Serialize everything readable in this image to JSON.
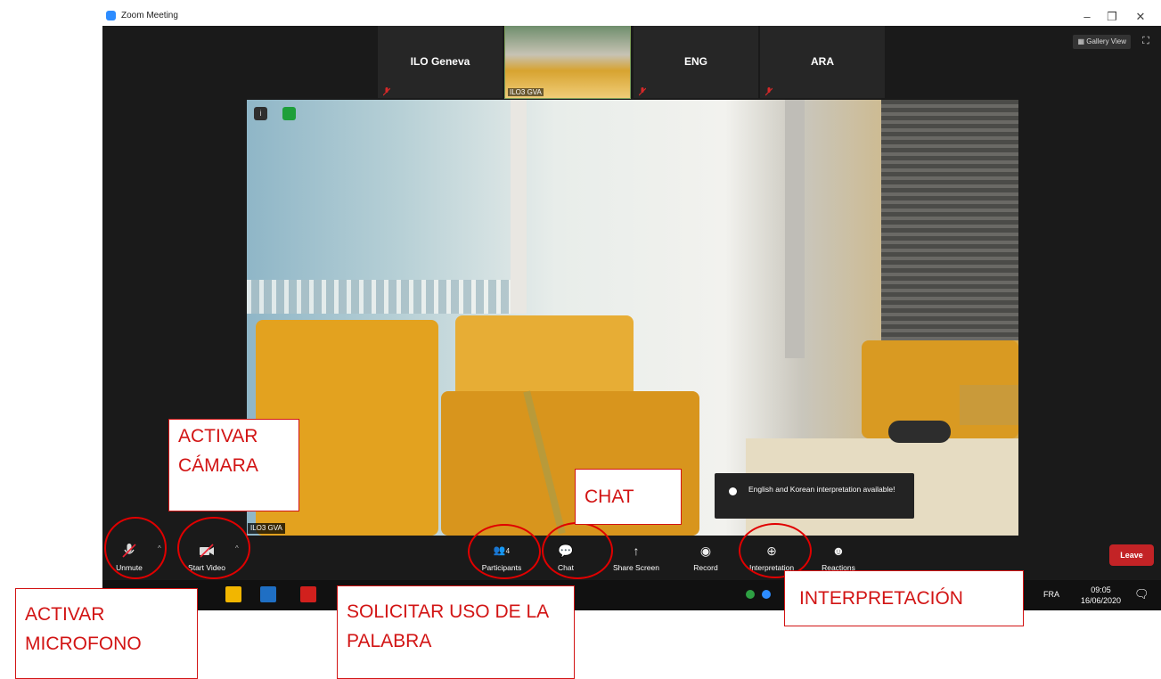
{
  "window": {
    "title": "Zoom Meeting",
    "controls": {
      "minimize": "–",
      "restore": "❐",
      "close": "✕"
    }
  },
  "top_bar": {
    "gallery_view_label": "Gallery View",
    "thumbnails": [
      {
        "name": "ILO Geneva",
        "muted": true
      },
      {
        "name": "ILO3 GVA",
        "video": true
      },
      {
        "name": "ENG",
        "muted": true
      },
      {
        "name": "ARA",
        "muted": true
      }
    ]
  },
  "video": {
    "participant_name": "ILO3 GVA"
  },
  "tooltip": {
    "text": "English and Korean interpretation available!"
  },
  "toolbar": {
    "unmute": "Unmute",
    "start_video": "Start Video",
    "participants": "Participants",
    "participants_count": "4",
    "chat": "Chat",
    "share_screen": "Share Screen",
    "record": "Record",
    "interpretation": "Interpretation",
    "reactions": "Reactions",
    "leave": "Leave"
  },
  "taskbar": {
    "language": "FRA",
    "time": "09:05",
    "date": "16/06/2020"
  },
  "annotations": {
    "activar_camara": "ACTIVAR CÁMARA",
    "activar_microfono": "ACTIVAR MICROFONO",
    "solicitar": "SOLICITAR USO DE LA PALABRA",
    "chat": "CHAT",
    "interpretacion": "INTERPRETACIÓN"
  },
  "colors": {
    "annotation": "#d21414",
    "leave": "#c32326",
    "share": "#1eb15a",
    "zoom_blue": "#2d8cff"
  }
}
